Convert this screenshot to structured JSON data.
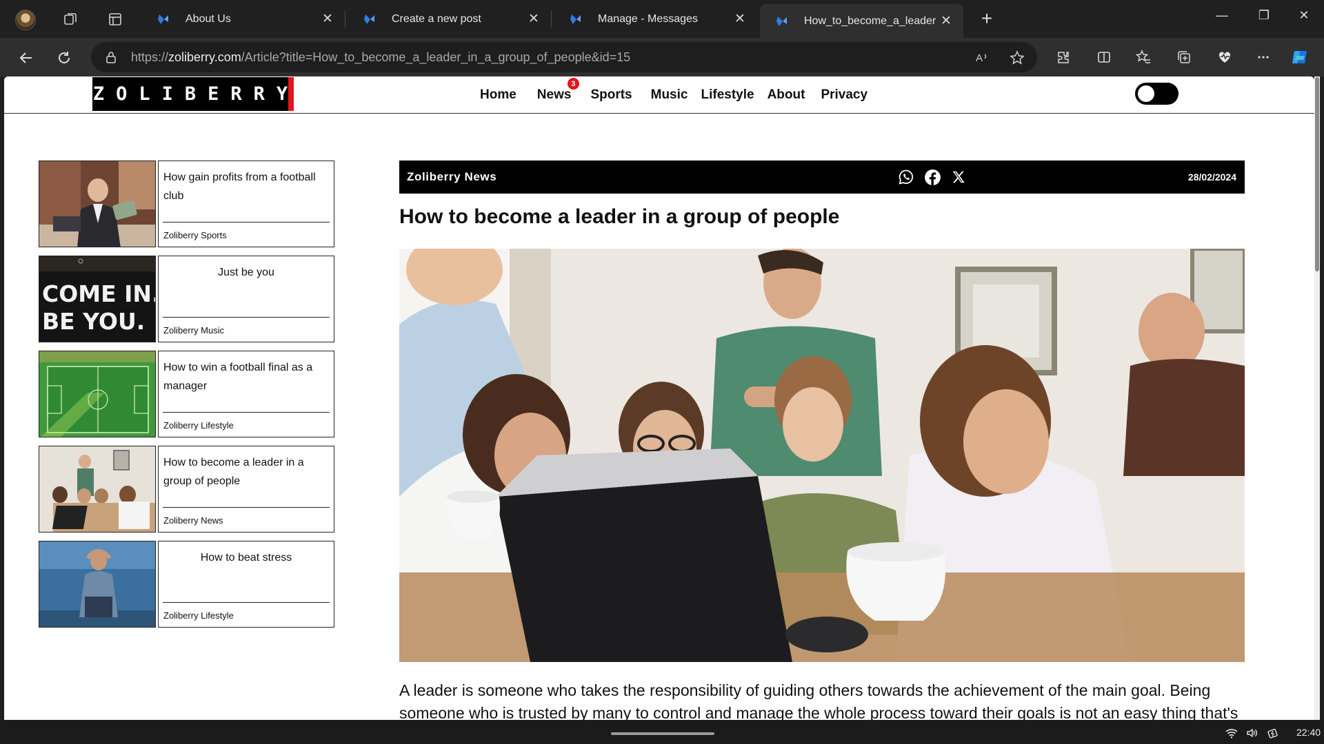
{
  "browser": {
    "tabs": [
      {
        "label": "About Us"
      },
      {
        "label": "Create a new post"
      },
      {
        "label": "Manage - Messages"
      },
      {
        "label": "How_to_become_a_leader_i"
      }
    ],
    "close_glyph": "✕",
    "new_tab_glyph": "+",
    "url_scheme": "https://",
    "url_domain": "zoliberry.com",
    "url_path": "/Article?title=How_to_become_a_leader_in_a_group_of_people&id=15",
    "window_controls": {
      "minimize": "—",
      "restore": "❐",
      "close": "✕"
    }
  },
  "site": {
    "logo_text": "ZOLIBERRY",
    "nav": [
      "Home",
      "News",
      "Sports",
      "Music",
      "Lifestyle",
      "About",
      "Privacy"
    ],
    "news_badge": "3",
    "dark_mode_on": false
  },
  "sidebar": [
    {
      "title": "How gain profits from a football club",
      "category": "Zoliberry Sports",
      "image": "businessman-with-cash"
    },
    {
      "title": "Just be you",
      "category": "Zoliberry Music",
      "image": "come-in-be-you-sign"
    },
    {
      "title": "How to win a football final as a manager",
      "category": "Zoliberry Lifestyle",
      "image": "football-pitch"
    },
    {
      "title": "How to become a leader in a group of people",
      "category": "Zoliberry News",
      "image": "group-at-laptop"
    },
    {
      "title": "How to beat stress",
      "category": "Zoliberry Lifestyle",
      "image": "stressed-man-by-sea"
    }
  ],
  "thumb_text": {
    "line1": "COME IN.",
    "line2": "BE YOU."
  },
  "article": {
    "source": "Zoliberry News",
    "date": "28/02/2024",
    "title": "How to become a leader in a group of people",
    "hero_image": "group-of-people-around-laptop",
    "body": "A leader is someone who takes the responsibility of guiding others towards the achievement of the main goal. Being someone who is trusted by many to control and manage the whole process toward their goals is not an easy thing that's"
  },
  "taskbar": {
    "time": "22:40"
  },
  "colors": {
    "accent_red": "#e4161c",
    "chrome_dark": "#202020",
    "edge_blue": "#2b7de9"
  }
}
